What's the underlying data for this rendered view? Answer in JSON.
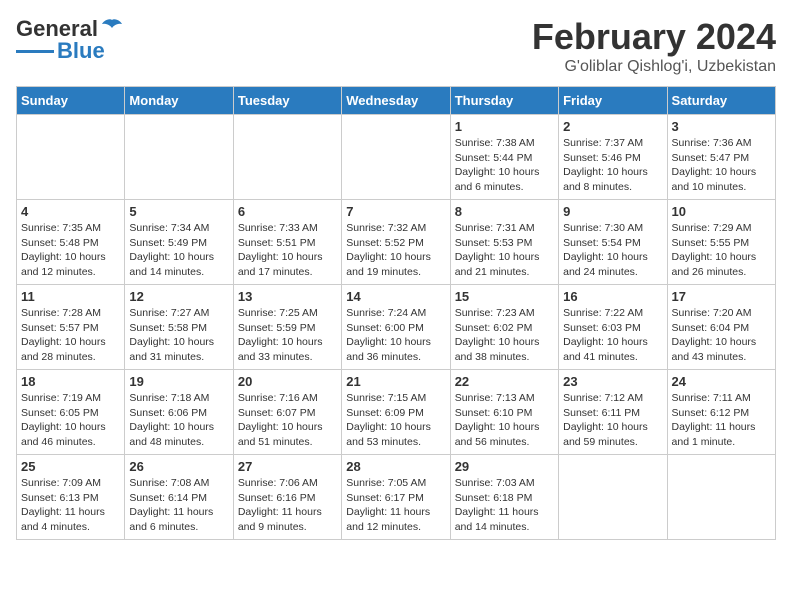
{
  "header": {
    "logo_general": "General",
    "logo_blue": "Blue",
    "title": "February 2024",
    "subtitle": "G'oliblar Qishlog'i, Uzbekistan"
  },
  "weekdays": [
    "Sunday",
    "Monday",
    "Tuesday",
    "Wednesday",
    "Thursday",
    "Friday",
    "Saturday"
  ],
  "weeks": [
    [
      null,
      null,
      null,
      null,
      {
        "day": "1",
        "sunrise": "Sunrise: 7:38 AM",
        "sunset": "Sunset: 5:44 PM",
        "daylight": "Daylight: 10 hours and 6 minutes."
      },
      {
        "day": "2",
        "sunrise": "Sunrise: 7:37 AM",
        "sunset": "Sunset: 5:46 PM",
        "daylight": "Daylight: 10 hours and 8 minutes."
      },
      {
        "day": "3",
        "sunrise": "Sunrise: 7:36 AM",
        "sunset": "Sunset: 5:47 PM",
        "daylight": "Daylight: 10 hours and 10 minutes."
      }
    ],
    [
      {
        "day": "4",
        "sunrise": "Sunrise: 7:35 AM",
        "sunset": "Sunset: 5:48 PM",
        "daylight": "Daylight: 10 hours and 12 minutes."
      },
      {
        "day": "5",
        "sunrise": "Sunrise: 7:34 AM",
        "sunset": "Sunset: 5:49 PM",
        "daylight": "Daylight: 10 hours and 14 minutes."
      },
      {
        "day": "6",
        "sunrise": "Sunrise: 7:33 AM",
        "sunset": "Sunset: 5:51 PM",
        "daylight": "Daylight: 10 hours and 17 minutes."
      },
      {
        "day": "7",
        "sunrise": "Sunrise: 7:32 AM",
        "sunset": "Sunset: 5:52 PM",
        "daylight": "Daylight: 10 hours and 19 minutes."
      },
      {
        "day": "8",
        "sunrise": "Sunrise: 7:31 AM",
        "sunset": "Sunset: 5:53 PM",
        "daylight": "Daylight: 10 hours and 21 minutes."
      },
      {
        "day": "9",
        "sunrise": "Sunrise: 7:30 AM",
        "sunset": "Sunset: 5:54 PM",
        "daylight": "Daylight: 10 hours and 24 minutes."
      },
      {
        "day": "10",
        "sunrise": "Sunrise: 7:29 AM",
        "sunset": "Sunset: 5:55 PM",
        "daylight": "Daylight: 10 hours and 26 minutes."
      }
    ],
    [
      {
        "day": "11",
        "sunrise": "Sunrise: 7:28 AM",
        "sunset": "Sunset: 5:57 PM",
        "daylight": "Daylight: 10 hours and 28 minutes."
      },
      {
        "day": "12",
        "sunrise": "Sunrise: 7:27 AM",
        "sunset": "Sunset: 5:58 PM",
        "daylight": "Daylight: 10 hours and 31 minutes."
      },
      {
        "day": "13",
        "sunrise": "Sunrise: 7:25 AM",
        "sunset": "Sunset: 5:59 PM",
        "daylight": "Daylight: 10 hours and 33 minutes."
      },
      {
        "day": "14",
        "sunrise": "Sunrise: 7:24 AM",
        "sunset": "Sunset: 6:00 PM",
        "daylight": "Daylight: 10 hours and 36 minutes."
      },
      {
        "day": "15",
        "sunrise": "Sunrise: 7:23 AM",
        "sunset": "Sunset: 6:02 PM",
        "daylight": "Daylight: 10 hours and 38 minutes."
      },
      {
        "day": "16",
        "sunrise": "Sunrise: 7:22 AM",
        "sunset": "Sunset: 6:03 PM",
        "daylight": "Daylight: 10 hours and 41 minutes."
      },
      {
        "day": "17",
        "sunrise": "Sunrise: 7:20 AM",
        "sunset": "Sunset: 6:04 PM",
        "daylight": "Daylight: 10 hours and 43 minutes."
      }
    ],
    [
      {
        "day": "18",
        "sunrise": "Sunrise: 7:19 AM",
        "sunset": "Sunset: 6:05 PM",
        "daylight": "Daylight: 10 hours and 46 minutes."
      },
      {
        "day": "19",
        "sunrise": "Sunrise: 7:18 AM",
        "sunset": "Sunset: 6:06 PM",
        "daylight": "Daylight: 10 hours and 48 minutes."
      },
      {
        "day": "20",
        "sunrise": "Sunrise: 7:16 AM",
        "sunset": "Sunset: 6:07 PM",
        "daylight": "Daylight: 10 hours and 51 minutes."
      },
      {
        "day": "21",
        "sunrise": "Sunrise: 7:15 AM",
        "sunset": "Sunset: 6:09 PM",
        "daylight": "Daylight: 10 hours and 53 minutes."
      },
      {
        "day": "22",
        "sunrise": "Sunrise: 7:13 AM",
        "sunset": "Sunset: 6:10 PM",
        "daylight": "Daylight: 10 hours and 56 minutes."
      },
      {
        "day": "23",
        "sunrise": "Sunrise: 7:12 AM",
        "sunset": "Sunset: 6:11 PM",
        "daylight": "Daylight: 10 hours and 59 minutes."
      },
      {
        "day": "24",
        "sunrise": "Sunrise: 7:11 AM",
        "sunset": "Sunset: 6:12 PM",
        "daylight": "Daylight: 11 hours and 1 minute."
      }
    ],
    [
      {
        "day": "25",
        "sunrise": "Sunrise: 7:09 AM",
        "sunset": "Sunset: 6:13 PM",
        "daylight": "Daylight: 11 hours and 4 minutes."
      },
      {
        "day": "26",
        "sunrise": "Sunrise: 7:08 AM",
        "sunset": "Sunset: 6:14 PM",
        "daylight": "Daylight: 11 hours and 6 minutes."
      },
      {
        "day": "27",
        "sunrise": "Sunrise: 7:06 AM",
        "sunset": "Sunset: 6:16 PM",
        "daylight": "Daylight: 11 hours and 9 minutes."
      },
      {
        "day": "28",
        "sunrise": "Sunrise: 7:05 AM",
        "sunset": "Sunset: 6:17 PM",
        "daylight": "Daylight: 11 hours and 12 minutes."
      },
      {
        "day": "29",
        "sunrise": "Sunrise: 7:03 AM",
        "sunset": "Sunset: 6:18 PM",
        "daylight": "Daylight: 11 hours and 14 minutes."
      },
      null,
      null
    ]
  ]
}
